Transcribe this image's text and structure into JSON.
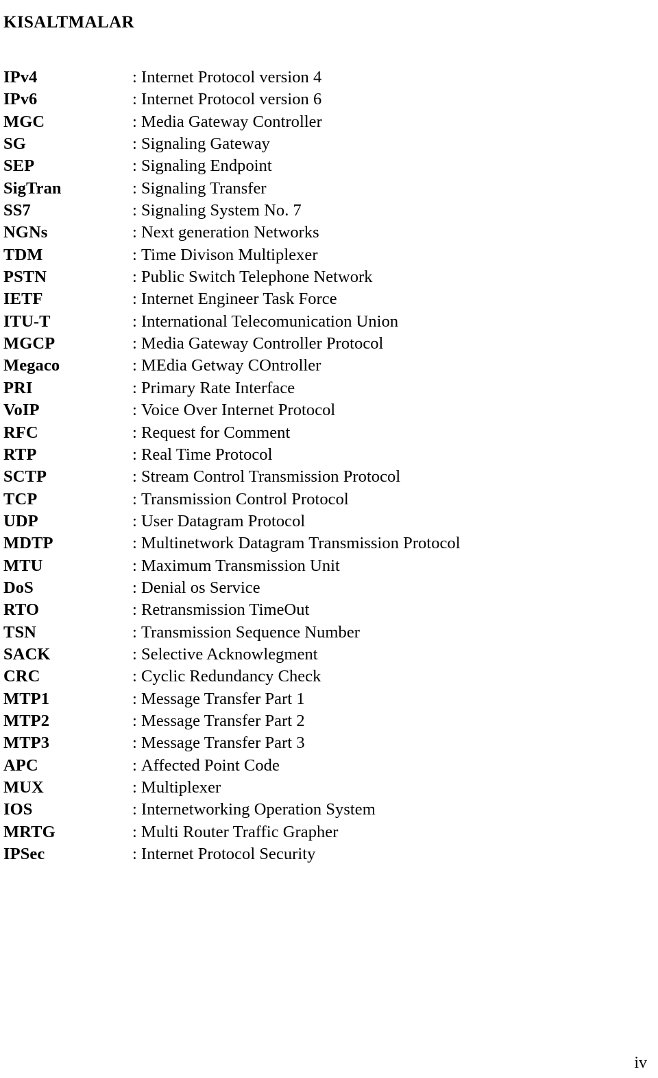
{
  "document": {
    "title": "KISALTMALAR",
    "separator": ":",
    "page_number": "iv"
  },
  "abbreviations": [
    {
      "term": "IPv4",
      "definition": "Internet Protocol version 4"
    },
    {
      "term": "IPv6",
      "definition": "Internet Protocol version 6"
    },
    {
      "term": "MGC",
      "definition": "Media Gateway Controller"
    },
    {
      "term": "SG",
      "definition": "Signaling Gateway"
    },
    {
      "term": "SEP",
      "definition": "Signaling Endpoint"
    },
    {
      "term": "SigTran",
      "definition": "Signaling Transfer"
    },
    {
      "term": "SS7",
      "definition": "Signaling System No. 7"
    },
    {
      "term": "NGNs",
      "definition": "Next generation Networks"
    },
    {
      "term": "TDM",
      "definition": "Time Divison Multiplexer"
    },
    {
      "term": "PSTN",
      "definition": "Public Switch Telephone Network"
    },
    {
      "term": "IETF",
      "definition": "Internet Engineer Task Force"
    },
    {
      "term": "ITU-T",
      "definition": "International Telecomunication Union"
    },
    {
      "term": "MGCP",
      "definition": "Media Gateway Controller Protocol"
    },
    {
      "term": "Megaco",
      "definition": "MEdia Getway COntroller"
    },
    {
      "term": "PRI",
      "definition": "Primary Rate Interface"
    },
    {
      "term": "VoIP",
      "definition": "Voice Over Internet Protocol"
    },
    {
      "term": "RFC",
      "definition": "Request for Comment"
    },
    {
      "term": "RTP",
      "definition": "Real Time Protocol"
    },
    {
      "term": "SCTP",
      "definition": "Stream Control Transmission Protocol"
    },
    {
      "term": "TCP",
      "definition": "Transmission Control Protocol"
    },
    {
      "term": "UDP",
      "definition": "User Datagram Protocol"
    },
    {
      "term": "MDTP",
      "definition": "Multinetwork Datagram Transmission Protocol"
    },
    {
      "term": "MTU",
      "definition": "Maximum Transmission Unit"
    },
    {
      "term": "DoS",
      "definition": "Denial os Service"
    },
    {
      "term": "RTO",
      "definition": "Retransmission TimeOut"
    },
    {
      "term": "TSN",
      "definition": "Transmission Sequence Number"
    },
    {
      "term": "SACK",
      "definition": "Selective Acknowlegment"
    },
    {
      "term": "CRC",
      "definition": "Cyclic Redundancy Check"
    },
    {
      "term": "MTP1",
      "definition": "Message Transfer Part 1"
    },
    {
      "term": "MTP2",
      "definition": "Message Transfer Part 2"
    },
    {
      "term": "MTP3",
      "definition": "Message Transfer Part 3"
    },
    {
      "term": "APC",
      "definition": "Affected Point Code"
    },
    {
      "term": "MUX",
      "definition": "Multiplexer"
    },
    {
      "term": "IOS",
      "definition": "Internetworking Operation System"
    },
    {
      "term": "MRTG",
      "definition": "Multi Router Traffic Grapher"
    },
    {
      "term": "IPSec",
      "definition": "Internet Protocol Security"
    }
  ]
}
